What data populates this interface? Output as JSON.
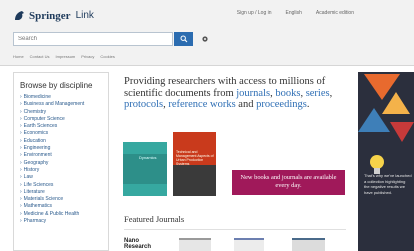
{
  "header": {
    "logo_springer": "Springer",
    "logo_link": "Link",
    "top_nav": [
      "Sign up / Log in",
      "English",
      "Academic edition"
    ],
    "search_placeholder": "Search",
    "filters": [
      "Home",
      "Contact Us",
      "Impressum",
      "Privacy",
      "Cookies"
    ]
  },
  "sidebar": {
    "title": "Browse by discipline",
    "items": [
      "Biomedicine",
      "Business and Management",
      "Chemistry",
      "Computer Science",
      "Earth Sciences",
      "Economics",
      "Education",
      "Engineering",
      "Environment",
      "Geography",
      "History",
      "Law",
      "Life Sciences",
      "Literature",
      "Materials Science",
      "Mathematics",
      "Medicine & Public Health",
      "Pharmacy"
    ]
  },
  "main": {
    "headline_part1": "Providing researchers with access to millions of scientific documents from ",
    "link_journals": "journals",
    "comma1": ", ",
    "link_books": "books",
    "comma2": ", ",
    "link_series": "series",
    "comma3": ", ",
    "link_protocols": "protocols",
    "comma4": ", ",
    "link_reference_works": "reference works",
    "and": " and ",
    "link_proceedings": "proceedings",
    "period": ".",
    "book1_title": "Dynamics",
    "book2_title": "Technical and Management Aspects of Urban Production Systems",
    "new_books_banner": "New books and journals are available every day.",
    "featured_heading": "Featured Journals",
    "journal1_title": "Nano Research"
  },
  "ad": {
    "text": "That's why we've launched a collection highlighting the negative results we have published."
  },
  "colors": {
    "accent": "#2f6fb5",
    "banner": "#a0195a",
    "search_button": "#2b6cb0"
  }
}
